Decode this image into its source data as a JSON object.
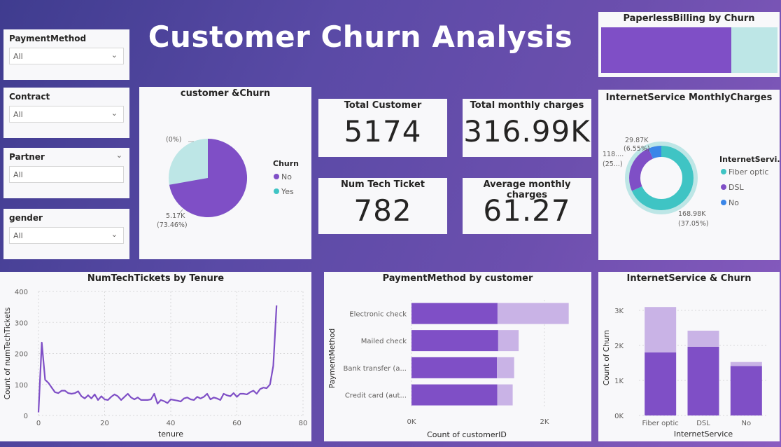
{
  "title": "Customer Churn Analysis",
  "slicers": [
    {
      "label": "PaymentMethod",
      "value": "All"
    },
    {
      "label": "Contract",
      "value": "All"
    },
    {
      "label": "Partner",
      "value": "All"
    },
    {
      "label": "gender",
      "value": "All"
    }
  ],
  "kpis": [
    {
      "label": "Total Customer",
      "value": "5174"
    },
    {
      "label": "Total monthly charges",
      "value": "316.99K"
    },
    {
      "label": "Num Tech Ticket",
      "value": "782"
    },
    {
      "label": "Average monthly charges",
      "value": "61.27"
    }
  ],
  "colors": {
    "purple": "#7f4fc6",
    "light_purple": "#c9b3e6",
    "teal": "#3fc4c4",
    "light_teal": "#bde6e6",
    "blue": "#3a86e8"
  },
  "pie": {
    "title": "customer &Churn",
    "legend_title": "Churn",
    "legend": [
      "No",
      "Yes"
    ],
    "label_no": "5.17K",
    "label_no_pct": "(73.46%)",
    "label_yes": "(0%)"
  },
  "paperless": {
    "title": "PaperlessBilling by Churn"
  },
  "donut": {
    "title": "InternetService MonthlyCharges",
    "legend_title": "InternetServi...",
    "legend": [
      "Fiber optic",
      "DSL",
      "No"
    ],
    "label_no": "29.87K",
    "label_no_pct": "(6.55%)",
    "label_dsl": "118....",
    "label_dsl_pct": "(25...)",
    "label_fiber": "168.98K",
    "label_fiber_pct": "(37.05%)"
  },
  "chart_data": [
    {
      "type": "line",
      "title": "NumTechTickets by Tenure",
      "xlabel": "tenure",
      "ylabel": "Count of numTechTickets",
      "xlim": [
        0,
        80
      ],
      "ylim": [
        0,
        400
      ],
      "xticks": [
        "0",
        "20",
        "40",
        "60",
        "80"
      ],
      "yticks": [
        "0",
        "100",
        "200",
        "300",
        "400"
      ],
      "grid": true,
      "x": [
        0,
        1,
        2,
        3,
        4,
        5,
        6,
        7,
        8,
        9,
        10,
        11,
        12,
        13,
        14,
        15,
        16,
        17,
        18,
        19,
        20,
        21,
        22,
        23,
        24,
        25,
        26,
        27,
        28,
        29,
        30,
        31,
        32,
        33,
        34,
        35,
        36,
        37,
        38,
        39,
        40,
        41,
        42,
        43,
        44,
        45,
        46,
        47,
        48,
        49,
        50,
        51,
        52,
        53,
        54,
        55,
        56,
        57,
        58,
        59,
        60,
        61,
        62,
        63,
        64,
        65,
        66,
        67,
        68,
        69,
        70,
        71,
        72
      ],
      "y": [
        10,
        235,
        115,
        105,
        90,
        75,
        72,
        80,
        80,
        72,
        70,
        72,
        78,
        62,
        55,
        65,
        55,
        68,
        50,
        62,
        52,
        50,
        60,
        68,
        62,
        50,
        60,
        70,
        58,
        52,
        58,
        50,
        50,
        50,
        52,
        70,
        38,
        50,
        46,
        40,
        52,
        50,
        48,
        45,
        55,
        58,
        52,
        50,
        60,
        55,
        60,
        70,
        52,
        58,
        55,
        50,
        70,
        65,
        62,
        72,
        60,
        70,
        70,
        68,
        75,
        80,
        70,
        85,
        90,
        88,
        100,
        160,
        355
      ]
    },
    {
      "type": "bar",
      "title": "PaymentMethod by customer",
      "xlabel": "Count of customerID",
      "ylabel": "PaymentMethod",
      "categories": [
        "Electronic check",
        "Mailed check",
        "Bank transfer (a...",
        "Credit card (aut..."
      ],
      "series": [
        {
          "name": "No",
          "values": [
            1294,
            1304,
            1286,
            1290
          ]
        },
        {
          "name": "Yes",
          "values": [
            1071,
            308,
            258,
            232
          ]
        }
      ],
      "xticks": [
        "0K",
        "2K"
      ],
      "xlim": [
        0,
        2400
      ]
    },
    {
      "type": "bar",
      "title": "InternetService & Churn",
      "xlabel": "InternetService",
      "ylabel": "Count of Churn",
      "categories": [
        "Fiber optic",
        "DSL",
        "No"
      ],
      "series": [
        {
          "name": "No",
          "values": [
            1799,
            1962,
            1413
          ]
        },
        {
          "name": "Yes",
          "values": [
            1297,
            459,
            113
          ]
        }
      ],
      "yticks": [
        "0K",
        "1K",
        "2K",
        "3K"
      ],
      "ylim": [
        0,
        3300
      ]
    }
  ]
}
